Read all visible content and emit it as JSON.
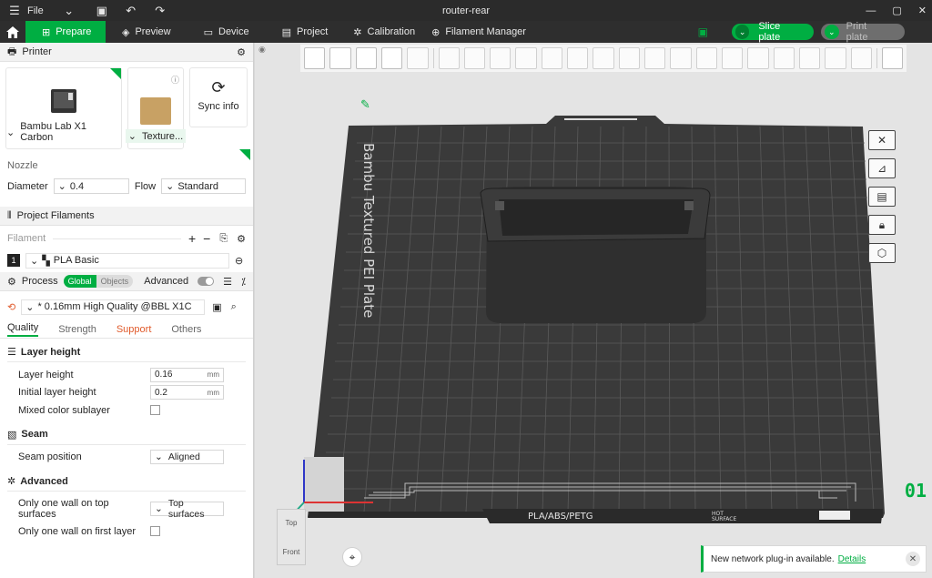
{
  "window": {
    "title": "router-rear",
    "menu_label": "File"
  },
  "tabs": [
    {
      "label": "Prepare"
    },
    {
      "label": "Preview"
    },
    {
      "label": "Device"
    },
    {
      "label": "Project"
    },
    {
      "label": "Calibration"
    },
    {
      "label": "Filament Manager"
    }
  ],
  "actions": {
    "slice_label": "Slice plate",
    "print_label": "Print plate"
  },
  "printer": {
    "section_title": "Printer",
    "model": "Bambu Lab X1 Carbon",
    "plate": "Texture...",
    "sync_label": "Sync info",
    "nozzle_title": "Nozzle",
    "diameter_label": "Diameter",
    "diameter_value": "0.4",
    "flow_label": "Flow",
    "flow_value": "Standard"
  },
  "filaments": {
    "section_title": "Project Filaments",
    "header_label": "Filament",
    "items": [
      {
        "index": "1",
        "name": "PLA Basic"
      }
    ]
  },
  "process": {
    "section_title": "Process",
    "scope_global": "Global",
    "scope_objects": "Objects",
    "advanced_label": "Advanced",
    "preset": "* 0.16mm High Quality @BBL X1C",
    "subtabs": [
      "Quality",
      "Strength",
      "Support",
      "Others"
    ],
    "groups": {
      "layer_height": {
        "title": "Layer height",
        "layer_height_label": "Layer height",
        "layer_height_value": "0.16",
        "initial_label": "Initial layer height",
        "initial_value": "0.2",
        "unit": "mm",
        "mixed_label": "Mixed color sublayer"
      },
      "seam": {
        "title": "Seam",
        "position_label": "Seam position",
        "position_value": "Aligned"
      },
      "advanced": {
        "title": "Advanced",
        "one_wall_top_label": "Only one wall on top surfaces",
        "one_wall_top_value": "Top surfaces",
        "one_wall_first_label": "Only one wall on first layer"
      }
    }
  },
  "viewport": {
    "plate_label": "Bambu Textured PEI Plate",
    "plate_materials": "PLA/ABS/PETG",
    "hot_surface_1": "HOT",
    "hot_surface_2": "SURFACE",
    "plate_number": "01",
    "view_top": "Top",
    "view_front": "Front"
  },
  "toast": {
    "message": "New network plug-in available.",
    "link": "Details"
  },
  "colors": {
    "accent": "#00ae42",
    "bed": "#3a3a3a",
    "model": "#2f2f2f"
  }
}
